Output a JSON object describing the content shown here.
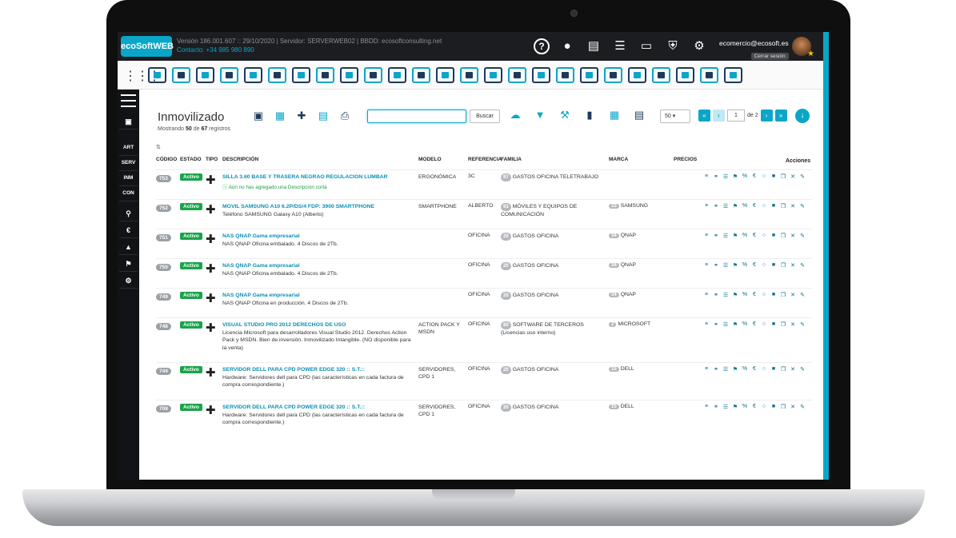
{
  "topbar": {
    "logo": "ecoSoftWEB",
    "info_line": "Versión 186.001.607 :: 29/10/2020 | Servidor: SERVERWEB02 | BBDD: ecosoftconsulting.net",
    "contact": "Contacto: +34 985 980 890",
    "icons": [
      "help-icon",
      "chat-icon",
      "document-icon",
      "server-icon",
      "chart-icon",
      "shield-icon",
      "gear-icon"
    ],
    "user_email": "ecomercio@ecosoft.es",
    "logout_label": "Cerrar sesión"
  },
  "sidebar": {
    "items": [
      "ART",
      "SERV",
      "INM",
      "CON"
    ]
  },
  "page": {
    "title": "Inmovilizado",
    "subtitle_prefix": "Mostrando",
    "shown": "50",
    "subtitle_mid": "de",
    "total": "67",
    "subtitle_suffix": "registros",
    "search_placeholder": "",
    "search_button": "Buscar",
    "per_page": "50",
    "current_page": "1",
    "page_of": "de 2"
  },
  "table": {
    "headers": [
      "CÓDIGO",
      "ESTADO",
      "TIPO",
      "DESCRIPCIÓN",
      "MODELO",
      "REFERENCIA",
      "FAMILIA",
      "MARCA",
      "PRECIOS",
      "Acciones"
    ],
    "rows": [
      {
        "code": "753",
        "status": "Activo",
        "title": "SILLA 3.60 BASE Y TRASERA NEGRAO REGULACION LUMBAR",
        "desc": "",
        "warn": "Aún no has agregado una Descripción corta",
        "model": "ERGONÓMICA",
        "ref": "3C",
        "family_count": "97",
        "family": "GASTOS OFICINA TELETRABAJO",
        "brand_count": "",
        "brand": ""
      },
      {
        "code": "752",
        "status": "Activo",
        "title": "MOVIL SAMSUNG A10 6.2P/DS/4 FDP: 3900 SMARTPHONE",
        "desc": "Teléfono SAMSUNG Galaxy A10 (Alberto)",
        "warn": "",
        "model": "SMARTPHONE",
        "ref": "ALBERTO",
        "family_count": "93",
        "family": "MÓVILES Y EQUIPOS DE COMUNICACIÓN",
        "brand_count": "33",
        "brand": "SAMSUNG"
      },
      {
        "code": "751",
        "status": "Activo",
        "title": "NAS QNAP Gama empresarial",
        "desc": "NAS QNAP Oficina embalado. 4 Discos de 2Tb.",
        "warn": "",
        "model": "",
        "ref": "OFICINA",
        "family_count": "20",
        "family": "GASTOS OFICINA",
        "brand_count": "34",
        "brand": "QNAP"
      },
      {
        "code": "750",
        "status": "Activo",
        "title": "NAS QNAP Gama empresarial",
        "desc": "NAS QNAP Oficina embalado. 4 Discos de 2Tb.",
        "warn": "",
        "model": "",
        "ref": "OFICINA",
        "family_count": "20",
        "family": "GASTOS OFICINA",
        "brand_count": "34",
        "brand": "QNAP"
      },
      {
        "code": "749",
        "status": "Activo",
        "title": "NAS QNAP Gama empresarial",
        "desc": "NAS QNAP Oficina en producción. 4 Discos de 2Tb.",
        "warn": "",
        "model": "",
        "ref": "OFICINA",
        "family_count": "20",
        "family": "GASTOS OFICINA",
        "brand_count": "34",
        "brand": "QNAP"
      },
      {
        "code": "748",
        "status": "Activo",
        "title": "VISUAL STUDIO PRO 2012 DERECHOS DE USO",
        "desc": "Licencia Microsoft para desarrolladores Visual Studio 2012. Derechos Action Pack y MSDN. Bien de inversión. Inmovilizado Intangible. (NO disponible para la venta)",
        "warn": "",
        "model": "ACTION PACK Y MSDN",
        "ref": "OFICINA",
        "family_count": "80",
        "family": "SOFTWARE DE TERCEROS (Licencias uso interno)",
        "brand_count": "2",
        "brand": "MICROSOFT"
      },
      {
        "code": "744",
        "status": "Activo",
        "title": "SERVIDOR DELL PARA CPD POWER EDGE 320 :: S.T.::",
        "desc": "Hardware: Servidores dell para CPD (las características en cada factura de compra correspondiente.)",
        "warn": "",
        "model": "SERVIDORES, CPD 1",
        "ref": "OFICINA",
        "family_count": "20",
        "family": "GASTOS OFICINA",
        "brand_count": "15",
        "brand": "DELL"
      },
      {
        "code": "708",
        "status": "Activo",
        "title": "SERVIDOR DELL PARA CPD POWER EDGE 320 :: S.T.::",
        "desc": "Hardware: Servidores dell para CPD (las características en cada factura de compra correspondiente.)",
        "warn": "",
        "model": "SERVIDORES, CPD 1",
        "ref": "OFICINA",
        "family_count": "20",
        "family": "GASTOS OFICINA",
        "brand_count": "15",
        "brand": "DELL"
      }
    ]
  }
}
